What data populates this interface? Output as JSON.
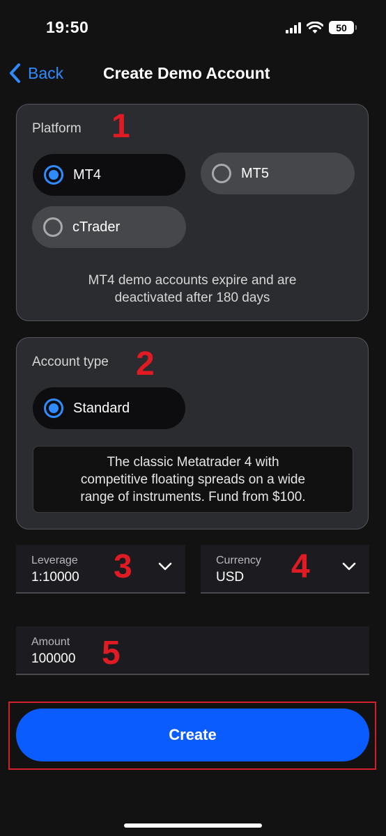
{
  "status_bar": {
    "time": "19:50",
    "battery": "50"
  },
  "nav": {
    "back_label": "Back",
    "title": "Create Demo Account"
  },
  "platform": {
    "label": "Platform",
    "options": [
      {
        "label": "MT4",
        "selected": true
      },
      {
        "label": "MT5",
        "selected": false
      },
      {
        "label": "cTrader",
        "selected": false
      }
    ],
    "note_line1": "MT4 demo accounts expire and are",
    "note_line2": "deactivated after 180 days"
  },
  "account_type": {
    "label": "Account type",
    "options": [
      {
        "label": "Standard",
        "selected": true
      }
    ],
    "description_line1": "The classic Metatrader 4 with",
    "description_line2": "competitive floating spreads on a wide",
    "description_line3": "range of instruments. Fund from $100."
  },
  "leverage": {
    "label": "Leverage",
    "value": "1:10000"
  },
  "currency": {
    "label": "Currency",
    "value": "USD"
  },
  "amount": {
    "label": "Amount",
    "value": "100000"
  },
  "create_button": {
    "label": "Create"
  },
  "annotations": {
    "marker_1": "1",
    "marker_2": "2",
    "marker_3": "3",
    "marker_4": "4",
    "marker_5": "5"
  },
  "colors": {
    "accent": "#2f8cff",
    "primary_button": "#0b5cff",
    "annotation": "#e01b24",
    "background": "#121212"
  }
}
